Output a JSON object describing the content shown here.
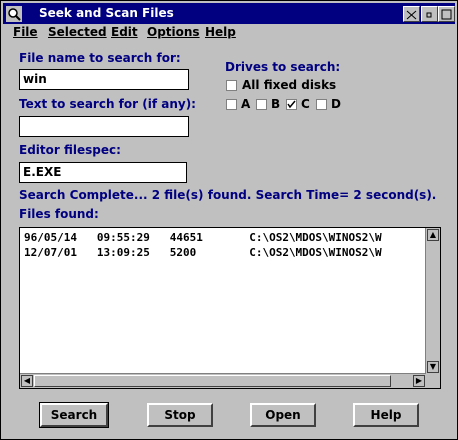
{
  "window": {
    "title": "Seek and Scan Files"
  },
  "menus": [
    "File",
    "Selected",
    "Edit",
    "Options",
    "Help"
  ],
  "form": {
    "filename_label": "File name to search for:",
    "filename_value": "win",
    "text_label": "Text to search for (if any):",
    "text_value": "",
    "editor_label": "Editor filespec:",
    "editor_value": "E.EXE"
  },
  "drives": {
    "label": "Drives to search:",
    "all_fixed": {
      "label": "All fixed disks",
      "checked": false
    },
    "items": [
      {
        "label": "A",
        "checked": false
      },
      {
        "label": "B",
        "checked": false
      },
      {
        "label": "C",
        "checked": true
      },
      {
        "label": "D",
        "checked": false
      }
    ]
  },
  "status": "Search Complete... 2 file(s) found.  Search Time= 2 second(s).",
  "files_label": "Files found:",
  "files": [
    {
      "date": "96/05/14",
      "time": "09:55:29",
      "size": "44651",
      "path": "C:\\OS2\\MDOS\\WINOS2\\W"
    },
    {
      "date": "12/07/01",
      "time": "13:09:25",
      "size": "5200",
      "path": "C:\\OS2\\MDOS\\WINOS2\\W"
    }
  ],
  "buttons": {
    "search": "Search",
    "stop": "Stop",
    "open": "Open",
    "help": "Help"
  }
}
